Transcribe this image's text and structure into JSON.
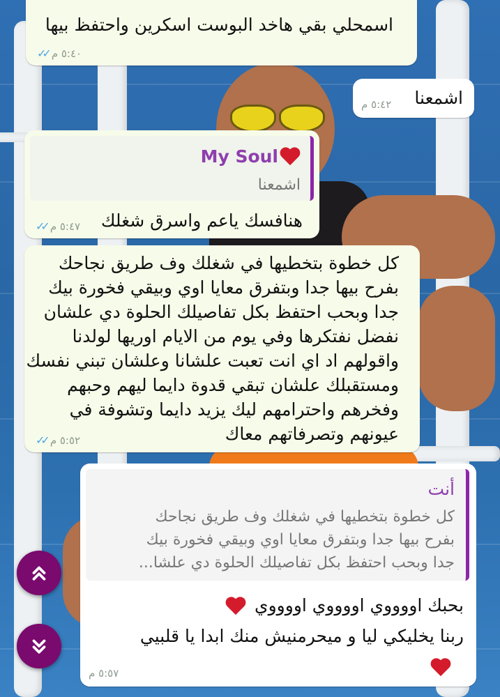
{
  "messages": [
    {
      "id": "m1",
      "text": "اسمحلي بقي هاخد البوست اسكرين واحتفظ بيها",
      "time": "٥:٤٠ م",
      "read": true
    },
    {
      "id": "m2",
      "text": "اشمعنا",
      "time": "٥:٤٢ م"
    },
    {
      "id": "m3",
      "quote_author": "My Soul",
      "quote_text": "اشمعنا",
      "text": "هنافسك ياعم واسرق شغلك",
      "time": "٥:٤٧ م",
      "read": true
    },
    {
      "id": "m4",
      "lines": [
        "كل خطوة بتخطيها في شغلك وف طريق نجاحك",
        "بفرح بيها جدا وبتفرق معايا اوي وبيقي فخورة بيك",
        "جدا وبحب احتفظ بكل تفاصيلك الحلوة دي علشان",
        "نفضل نفتكرها وفي يوم من الايام اوريها لولدنا",
        "واقولهم اد اي انت تعبت علشانا وعلشان تبني نفسك",
        "ومستقبلك علشان تبقي قدوة دايما ليهم وحبهم",
        "وفخرهم واحترامهم ليك يزيد دايما وتشوفة في",
        "عيونهم وتصرفاتهم معاك"
      ],
      "time": "٥:٥٢ م",
      "read": true
    },
    {
      "id": "m5",
      "quote_author": "أنت",
      "quote_lines": [
        "كل خطوة بتخطيها في شغلك وف طريق نجاحك",
        "بفرح بيها جدا وبتفرق معايا اوي وبيقي فخورة بيك",
        "جدا وبحب احتفظ بكل تفاصيلك الحلوة دي علشا..."
      ],
      "line1": "بحبك اووووي اووووي اووووي",
      "line2": "ربنا يخليكي ليا و ميحرمنيش منك ابدا يا قلبيي",
      "time": "٥:٥٧ م"
    }
  ],
  "icons": {
    "heart": "red-heart-icon",
    "ticks": "double-check-icon",
    "scroll_up": "double-chevron-up-icon",
    "scroll_down": "double-chevron-down-icon"
  },
  "colors": {
    "accent": "#7a0a6d",
    "incoming_bubble": "#f7fbe9",
    "outgoing_bubble": "#ffffff",
    "tick_blue": "#4fa7e6",
    "heart": "#d41b2c"
  }
}
